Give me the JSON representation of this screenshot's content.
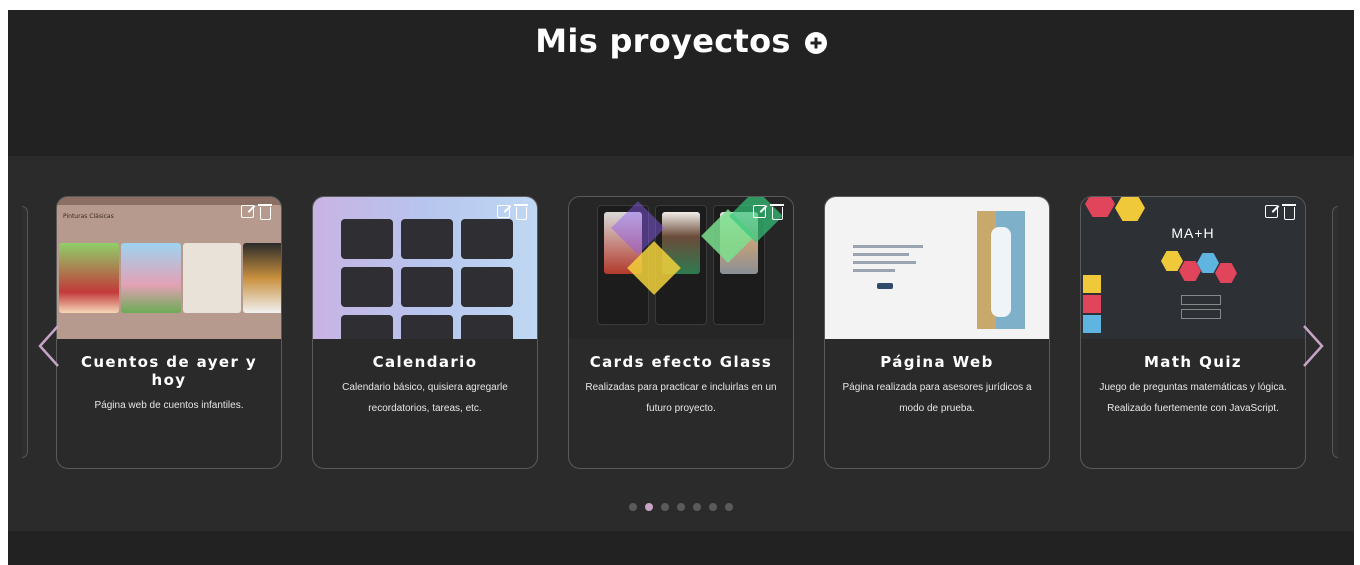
{
  "header": {
    "title": "Mis proyectos",
    "add_icon": "plus-circle-icon"
  },
  "thumb_text": {
    "cuentos_label": "Pinturas Clásicas",
    "math_logo": "MA+H"
  },
  "projects": [
    {
      "title": "Cuentos de ayer y hoy",
      "description": "Página web de cuentos infantiles."
    },
    {
      "title": "Calendario",
      "description": "Calendario básico, quisiera agregarle recordatorios, tareas, etc."
    },
    {
      "title": "Cards efecto Glass",
      "description": "Realizadas para practicar e incluirlas en un futuro proyecto."
    },
    {
      "title": "Página Web",
      "description": "Página realizada para asesores jurídicos a modo de prueba."
    },
    {
      "title": "Math Quiz",
      "description": "Juego de preguntas matemáticas y lógica. Realizado fuertemente con JavaScript."
    }
  ],
  "carousel": {
    "total_slides": 7,
    "active_slide": 2
  },
  "colors": {
    "accent": "#c7a3c5",
    "background": "#222222",
    "band": "#2b2b2b",
    "card": "#2a2a2a"
  },
  "icons": {
    "prev": "chevron-left-icon",
    "next": "chevron-right-icon",
    "edit": "edit-icon",
    "delete": "trash-icon"
  }
}
